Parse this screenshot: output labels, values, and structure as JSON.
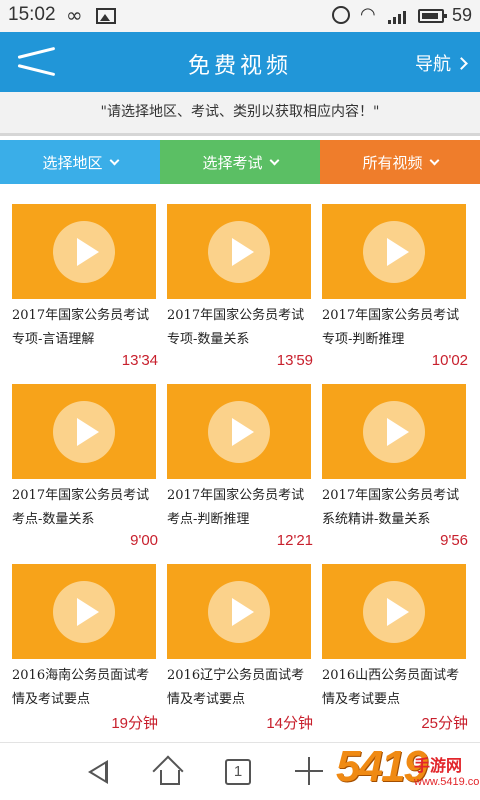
{
  "status_bar": {
    "time": "15:02",
    "infinity_glyph": "∞",
    "battery_level": "59",
    "icons": [
      "infinity-icon",
      "image-icon",
      "alarm-icon",
      "wifi-icon",
      "signal-icon",
      "battery-icon"
    ]
  },
  "header": {
    "back_icon": "back-arrow-icon",
    "title": "免费视频",
    "nav_label": "导航"
  },
  "notice": {
    "text": "\"请选择地区、考试、类别以获取相应内容！\""
  },
  "filters": [
    {
      "label": "选择地区",
      "color": "#3aaee8"
    },
    {
      "label": "选择考试",
      "color": "#5bbf64"
    },
    {
      "label": "所有视频",
      "color": "#ef7d2b"
    }
  ],
  "videos": [
    {
      "title": "2017年国家公务员考试专项-言语理解",
      "duration": "13'34"
    },
    {
      "title": "2017年国家公务员考试专项-数量关系",
      "duration": "13'59"
    },
    {
      "title": "2017年国家公务员考试专项-判断推理",
      "duration": "10'02"
    },
    {
      "title": "2017年国家公务员考试考点-数量关系",
      "duration": "9'00"
    },
    {
      "title": "2017年国家公务员考试考点-判断推理",
      "duration": "12'21"
    },
    {
      "title": "2017年国家公务员考试系统精讲-数量关系",
      "duration": "9'56"
    },
    {
      "title": "2016海南公务员面试考情及考试要点",
      "duration": "19分钟"
    },
    {
      "title": "2016辽宁公务员面试考情及考试要点",
      "duration": "14分钟"
    },
    {
      "title": "2016山西公务员面试考情及考试要点",
      "duration": "25分钟"
    }
  ],
  "bottom_nav": {
    "tabs_count": "1",
    "icons": [
      "back-icon",
      "home-icon",
      "tabs-icon",
      "plus-icon"
    ]
  },
  "watermark": {
    "number": "5419",
    "site": "手游网",
    "url": "www.5419.com"
  },
  "colors": {
    "header": "#2196d8",
    "thumb": "#f7a31a",
    "duration": "#c8202d"
  }
}
